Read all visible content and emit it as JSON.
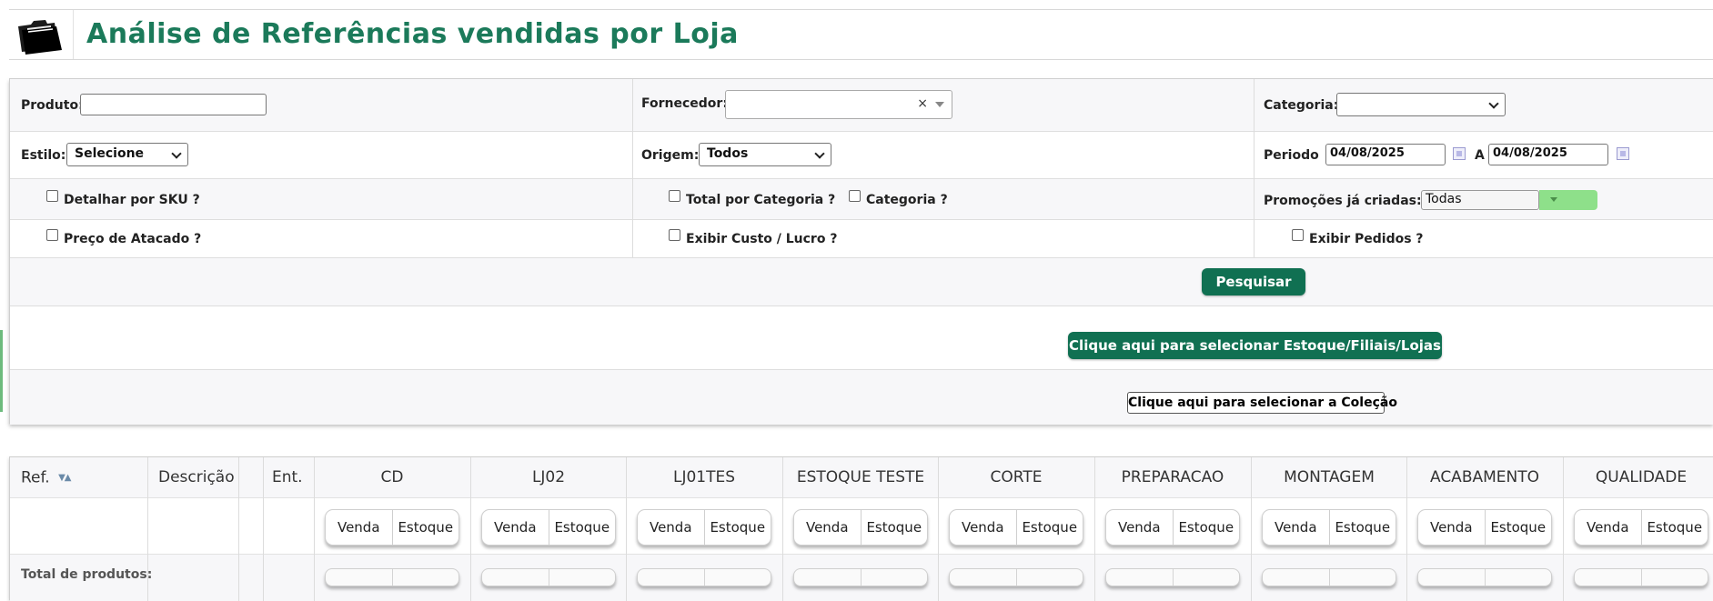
{
  "header": {
    "title": "Análise de Referências vendidas por Loja",
    "icon": "folder-icon"
  },
  "filters": {
    "produto_label": "Produto:",
    "produto_value": "",
    "fornecedor_label": "Fornecedor:",
    "fornecedor_clear": "×",
    "categoria_label": "Categoria:",
    "categoria_value": "",
    "estilo_label": "Estilo:",
    "estilo_value": "Selecione",
    "origem_label": "Origem:",
    "origem_value": "Todos",
    "periodo_label": "Periodo",
    "periodo_from": "04/08/2025",
    "periodo_sep": "A",
    "periodo_to": "04/08/2025",
    "detalhar_sku": "Detalhar por SKU ?",
    "total_categoria": "Total por Categoria ?",
    "categoria_check": "Categoria ?",
    "promocoes_label": "Promoções já criadas:",
    "promocoes_value": "Todas",
    "preco_atacado": "Preço de Atacado ?",
    "exibir_custo": "Exibir Custo / Lucro ?",
    "exibir_pedidos": "Exibir Pedidos ?"
  },
  "actions": {
    "pesquisar": "Pesquisar",
    "select_estoque": "Clique aqui para selecionar Estoque/Filiais/Lojas",
    "select_colecao": "Clique aqui para selecionar a Coleção"
  },
  "grid": {
    "col_ref": "Ref.",
    "col_descricao": "Descrição",
    "col_ent": "Ent.",
    "total_label": "Total de produtos:",
    "sub_venda": "Venda",
    "sub_estoque": "Estoque",
    "stores": [
      "CD",
      "LJ02",
      "LJ01TES",
      "ESTOQUE TESTE",
      "CORTE",
      "PREPARACAO",
      "MONTAGEM",
      "ACABAMENTO",
      "QUALIDADE"
    ]
  },
  "colors": {
    "accent": "#1b7a5a",
    "button": "#107052",
    "promo_toggle": "#8ee08a"
  }
}
